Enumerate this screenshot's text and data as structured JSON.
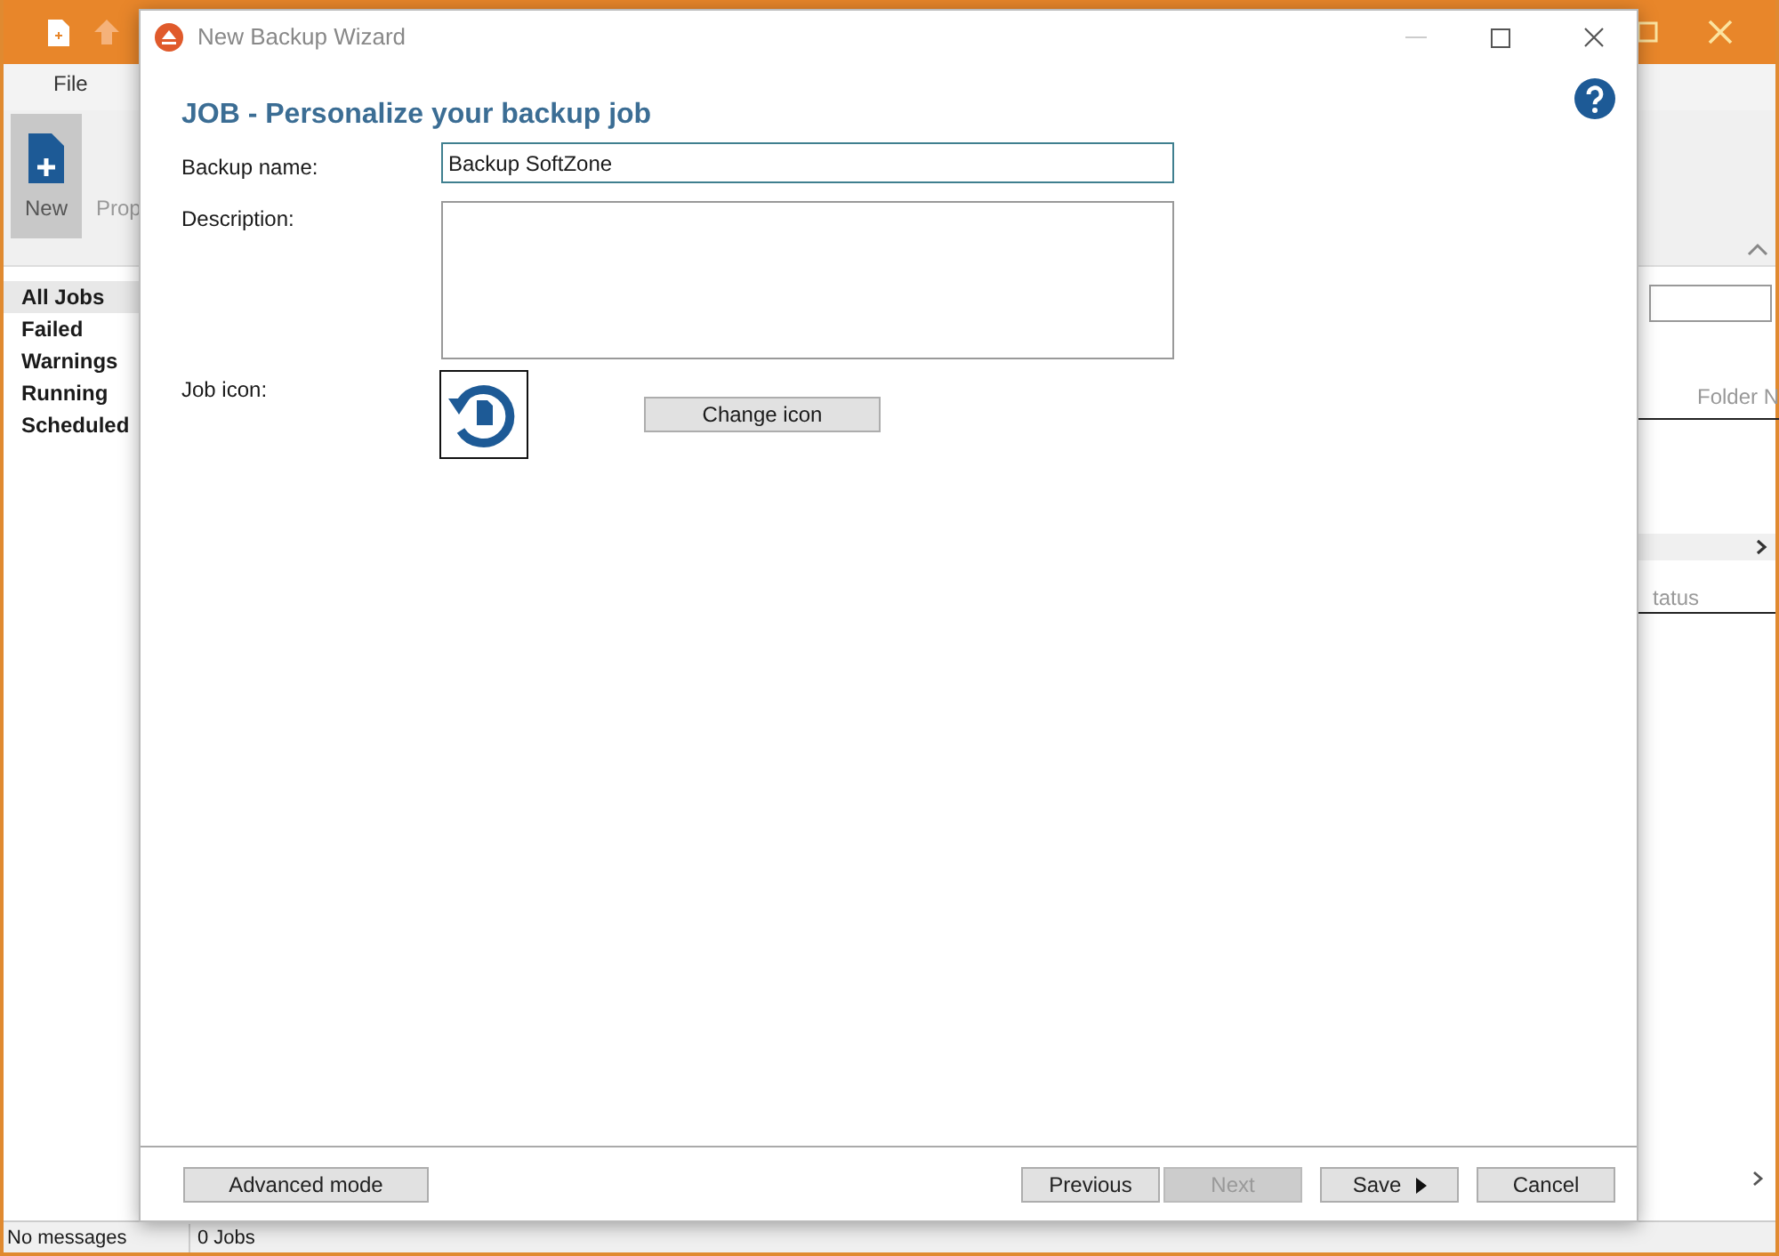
{
  "app": {
    "tabs": [
      {
        "label": "File",
        "selected": false
      }
    ],
    "ribbon": [
      {
        "label": "New",
        "selected": true
      },
      {
        "label": "Prop",
        "selected": false
      }
    ],
    "sidebar": [
      {
        "label": "All Jobs",
        "selected": true
      },
      {
        "label": "Failed",
        "selected": false
      },
      {
        "label": "Warnings",
        "selected": false
      },
      {
        "label": "Running",
        "selected": false
      },
      {
        "label": "Scheduled",
        "selected": false
      }
    ],
    "columns": [
      "Folder N",
      "tatus"
    ],
    "status_bar": [
      "No messages",
      "0 Jobs"
    ]
  },
  "dialog": {
    "title": "New Backup Wizard",
    "heading": "JOB - Personalize your backup job",
    "name_label": "Backup name:",
    "name_value": "Backup SoftZone",
    "description_label": "Description:",
    "job_icon_label": "Job icon:",
    "change_icon_button": "Change icon",
    "buttons": [
      {
        "label": "Advanced mode",
        "disabled": false,
        "kind": "plain"
      },
      {
        "label": "Previous",
        "disabled": false,
        "kind": "plain"
      },
      {
        "label": "Next",
        "disabled": true,
        "kind": "plain"
      },
      {
        "label": "Save",
        "disabled": false,
        "kind": "menu"
      },
      {
        "label": "Cancel",
        "disabled": false,
        "kind": "plain"
      }
    ]
  }
}
